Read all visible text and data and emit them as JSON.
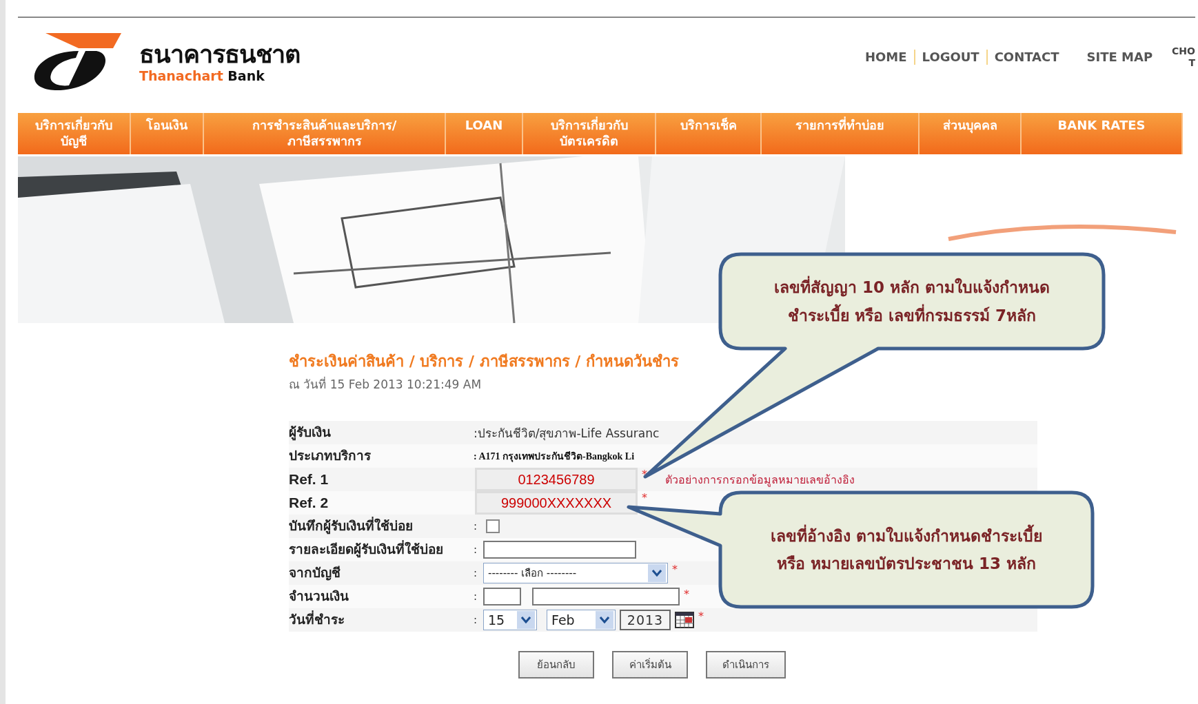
{
  "logo": {
    "thai": "ธนาคารธนชาต",
    "english_1": "Thanachart",
    "english_2": "Bank"
  },
  "top_links": [
    {
      "label": "HOME"
    },
    {
      "label": "LOGOUT"
    },
    {
      "label": "CONTACT"
    }
  ],
  "site_map": "SITE MAP",
  "language_toggle": {
    "line_1": "CHO",
    "line_2": "T"
  },
  "nav": [
    {
      "lines": [
        "บริการเกี่ยวกับ",
        "บัญชี"
      ]
    },
    {
      "lines": [
        "โอนเงิน"
      ]
    },
    {
      "lines": [
        "การชำระสินค้าและบริการ/",
        "ภาษีสรรพากร"
      ]
    },
    {
      "lines": [
        "LOAN"
      ]
    },
    {
      "lines": [
        "บริการเกี่ยวกับ",
        "บัตรเครดิต"
      ]
    },
    {
      "lines": [
        "บริการเช็ค"
      ]
    },
    {
      "lines": [
        "รายการที่ทำบ่อย"
      ]
    },
    {
      "lines": [
        "ส่วนบุคคล"
      ]
    },
    {
      "lines": [
        "BANK RATES"
      ]
    }
  ],
  "page_title": "ชำระเงินค่าสินค้า / บริการ / ภาษีสรรพากร / กำหนดวันชำร",
  "timestamp": "ณ วันที่  15 Feb 2013 10:21:49 AM",
  "form": [
    {
      "kind": "text",
      "label": "ผู้รับเงิน",
      "value": ":ประกันชีวิต/สุขภาพ-Life Assuranc"
    },
    {
      "kind": "service",
      "label": "ประเภทบริการ",
      "value": ": A171 กรุงเทพประกันชีวิต-Bangkok Li"
    },
    {
      "kind": "ref",
      "label": "Ref. 1",
      "value": "0123456789",
      "required": "*",
      "hint": "ตัวอย่างการกรอกข้อมูลหมายเลขอ้างอิง"
    },
    {
      "kind": "ref",
      "label": "Ref. 2",
      "value": "999000XXXXXXX",
      "required": "*"
    },
    {
      "kind": "checkbox",
      "label": "บันทึกผู้รับเงินที่ใช้บ่อย",
      "colon": ":",
      "checked": false
    },
    {
      "kind": "input",
      "label": "รายละเอียดผู้รับเงินที่ใช้บ่อย",
      "colon": ":"
    },
    {
      "kind": "select",
      "label": "จากบัญชี",
      "colon": ":",
      "value": "-------- เลือก --------",
      "required": "*"
    },
    {
      "kind": "amount",
      "label": "จำนวนเงิน",
      "colon": ":",
      "required": "*"
    },
    {
      "kind": "date",
      "label": "วันที่ชำระ",
      "colon": ":",
      "day": "15",
      "month": "Feb",
      "year": "2013",
      "required": "*"
    }
  ],
  "buttons": [
    {
      "label": "ย้อนกลับ"
    },
    {
      "label": "ค่าเริ่มต้น"
    },
    {
      "label": "ดำเนินการ"
    }
  ],
  "callouts": [
    {
      "lines": [
        "เลขที่สัญญา 10 หลัก  ตามใบแจ้งกำหนด",
        "ชำระเบี้ย หรือ เลขที่กรมธรรม์ 7หลัก"
      ]
    },
    {
      "lines": [
        "เลขที่อ้างอิง ตามใบแจ้งกำหนดชำระเบี้ย",
        "หรือ หมายเลขบัตรประชาชน 13 หลัก"
      ]
    }
  ]
}
